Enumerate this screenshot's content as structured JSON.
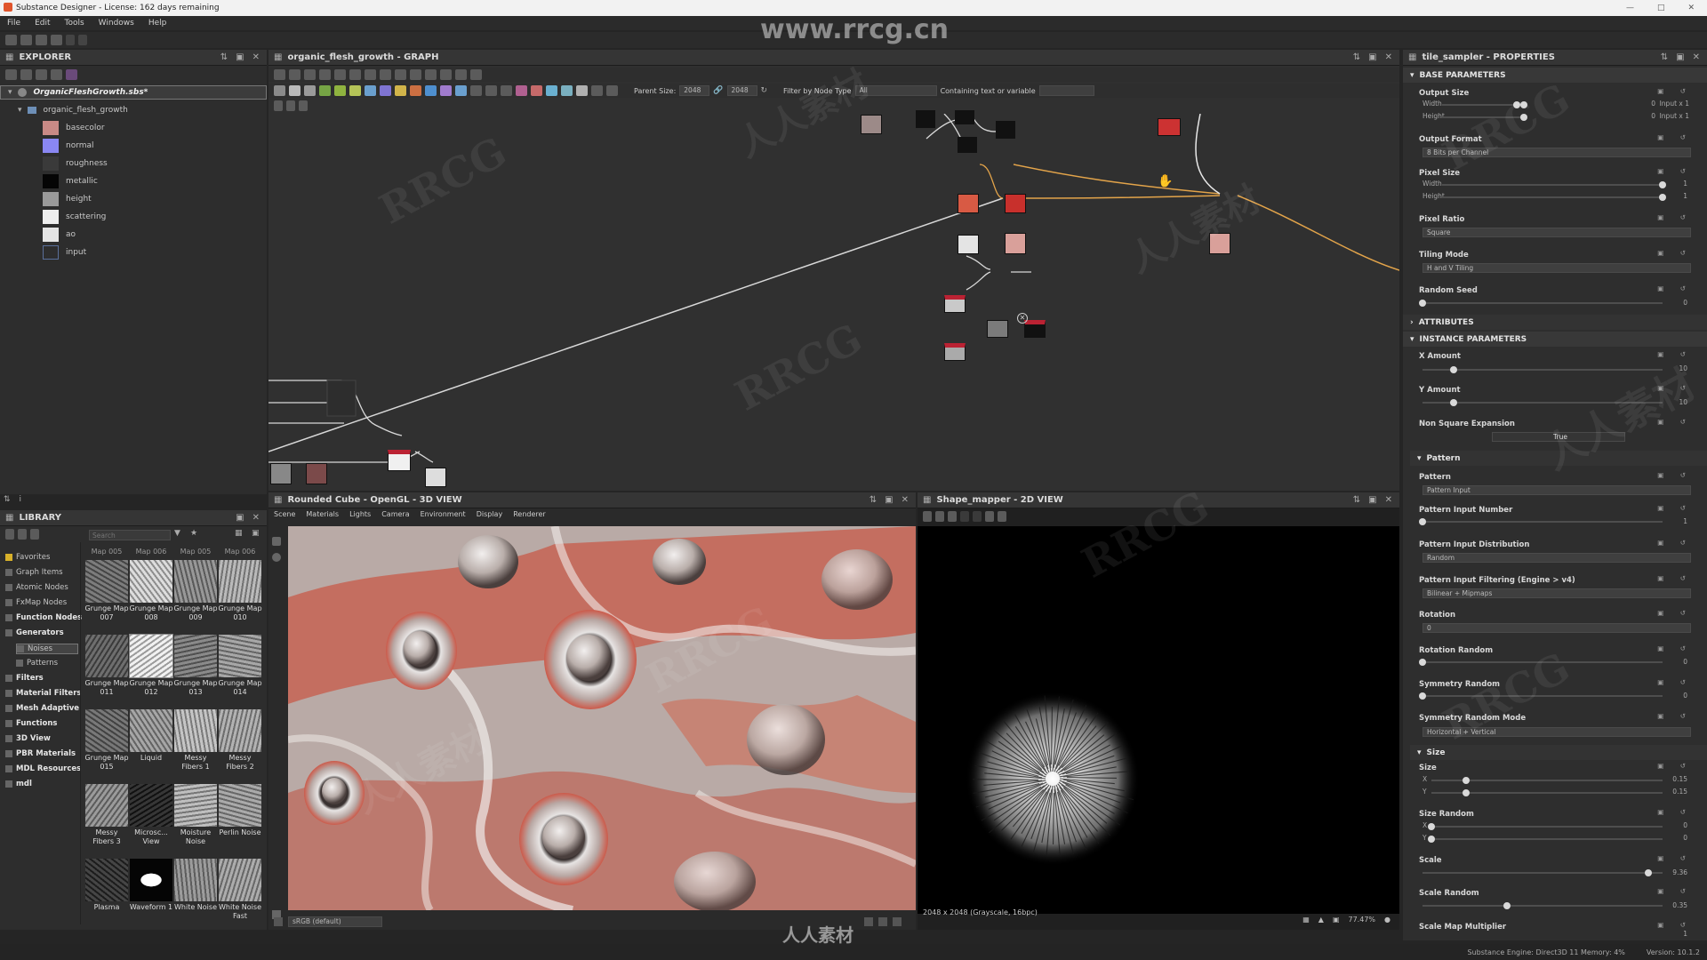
{
  "window": {
    "title": "Substance Designer - License: 162 days remaining"
  },
  "watermark": {
    "site": "www.rrcg.cn",
    "logo": "RRCG",
    "cn": "人人素材"
  },
  "menu": [
    "File",
    "Edit",
    "Tools",
    "Windows",
    "Help"
  ],
  "explorer": {
    "title": "EXPLORER",
    "package": "OrganicFleshGrowth.sbs*",
    "graph": "organic_flesh_growth",
    "outputs": [
      {
        "label": "basecolor",
        "color": "#c98a86"
      },
      {
        "label": "normal",
        "color": "#8a87f2"
      },
      {
        "label": "roughness",
        "color": "#3a3a3a"
      },
      {
        "label": "metallic",
        "color": "#050505"
      },
      {
        "label": "height",
        "color": "#9a9a9a"
      },
      {
        "label": "scattering",
        "color": "#eeeeee"
      },
      {
        "label": "ao",
        "color": "#e4e4e4"
      },
      {
        "label": "input",
        "color": "#2d2d2d"
      }
    ]
  },
  "graph": {
    "title": "organic_flesh_growth - GRAPH",
    "parent_size_label": "Parent Size:",
    "parent_size": "2048",
    "size2": "2048",
    "filter_label": "Filter by Node Type",
    "filter_value": "All",
    "containing_label": "Containing text or variable"
  },
  "library": {
    "title": "LIBRARY",
    "search_placeholder": "Search",
    "categories": [
      {
        "label": "Favorites",
        "bold": false
      },
      {
        "label": "Graph Items",
        "bold": false
      },
      {
        "label": "Atomic Nodes",
        "bold": false
      },
      {
        "label": "FxMap Nodes",
        "bold": false
      },
      {
        "label": "Function Nodes",
        "bold": true
      },
      {
        "label": "Generators",
        "bold": true
      },
      {
        "label": "Noises",
        "bold": false
      },
      {
        "label": "Patterns",
        "bold": false
      },
      {
        "label": "Filters",
        "bold": true
      },
      {
        "label": "Material Filters",
        "bold": true
      },
      {
        "label": "Mesh Adaptive",
        "bold": true
      },
      {
        "label": "Functions",
        "bold": true
      },
      {
        "label": "3D View",
        "bold": true
      },
      {
        "label": "PBR Materials",
        "bold": true
      },
      {
        "label": "MDL Resources",
        "bold": true
      },
      {
        "label": "mdl",
        "bold": true
      }
    ],
    "top_labels": [
      "Map 005",
      "Map 006",
      "Map 005",
      "Map 006"
    ],
    "thumbs": [
      {
        "label": "Grunge Map 007"
      },
      {
        "label": "Grunge Map 008"
      },
      {
        "label": "Grunge Map 009"
      },
      {
        "label": "Grunge Map 010"
      },
      {
        "label": "Grunge Map 011"
      },
      {
        "label": "Grunge Map 012"
      },
      {
        "label": "Grunge Map 013"
      },
      {
        "label": "Grunge Map 014"
      },
      {
        "label": "Grunge Map 015"
      },
      {
        "label": "Liquid"
      },
      {
        "label": "Messy Fibers 1"
      },
      {
        "label": "Messy Fibers 2"
      },
      {
        "label": "Messy Fibers 3"
      },
      {
        "label": "Microsc... View"
      },
      {
        "label": "Moisture Noise"
      },
      {
        "label": "Perlin Noise"
      },
      {
        "label": "Plasma"
      },
      {
        "label": "Waveform 1"
      },
      {
        "label": "White Noise"
      },
      {
        "label": "White Noise Fast"
      }
    ]
  },
  "view3d": {
    "title": "Rounded Cube - OpenGL - 3D VIEW",
    "menu": [
      "Scene",
      "Materials",
      "Lights",
      "Camera",
      "Environment",
      "Display",
      "Renderer"
    ],
    "colorspace": "sRGB (default)"
  },
  "view2d": {
    "title": "Shape_mapper - 2D VIEW",
    "info": "2048 x 2048 (Grayscale, 16bpc)",
    "zoom": "77.47%"
  },
  "properties": {
    "title": "tile_sampler - PROPERTIES",
    "base_header": "BASE PARAMETERS",
    "output_size": {
      "label": "Output Size",
      "width_label": "Width",
      "height_label": "Height",
      "width_val": "0",
      "height_val": "0",
      "width_rel": "Input x 1",
      "height_rel": "Input x 1"
    },
    "output_format": {
      "label": "Output Format",
      "value": "8 Bits per Channel"
    },
    "pixel_size": {
      "label": "Pixel Size",
      "width_label": "Width",
      "height_label": "Height",
      "width_val": "1",
      "height_val": "1"
    },
    "pixel_ratio": {
      "label": "Pixel Ratio",
      "value": "Square"
    },
    "tiling_mode": {
      "label": "Tiling Mode",
      "value": "H and V Tiling"
    },
    "random_seed": {
      "label": "Random Seed",
      "value": "0"
    },
    "attributes_header": "ATTRIBUTES",
    "instance_header": "INSTANCE PARAMETERS",
    "x_amount": {
      "label": "X Amount",
      "value": "10"
    },
    "y_amount": {
      "label": "Y Amount",
      "value": "10"
    },
    "non_square": {
      "label": "Non Square Expansion",
      "value": "True"
    },
    "pattern_header": "Pattern",
    "pattern": {
      "label": "Pattern",
      "value": "Pattern Input"
    },
    "pattern_input_number": {
      "label": "Pattern Input Number",
      "value": "1"
    },
    "pattern_input_distribution": {
      "label": "Pattern Input Distribution",
      "value": "Random"
    },
    "pattern_input_filtering": {
      "label": "Pattern Input Filtering (Engine > v4)",
      "value": "Bilinear + Mipmaps"
    },
    "rotation": {
      "label": "Rotation",
      "value": "0"
    },
    "rotation_random": {
      "label": "Rotation Random",
      "value": "0"
    },
    "symmetry_random": {
      "label": "Symmetry Random",
      "value": "0"
    },
    "symmetry_random_mode": {
      "label": "Symmetry Random Mode",
      "value": "Horizontal + Vertical"
    },
    "size_header": "Size",
    "size": {
      "label": "Size",
      "x_label": "X",
      "y_label": "Y",
      "x_val": "0.15",
      "y_val": "0.15"
    },
    "size_random": {
      "label": "Size Random",
      "x_label": "X",
      "y_label": "Y",
      "x_val": "0",
      "y_val": "0"
    },
    "scale": {
      "label": "Scale",
      "value": "9.36"
    },
    "scale_random": {
      "label": "Scale Random",
      "value": "0.35"
    },
    "scale_map_multiplier": {
      "label": "Scale Map Multiplier",
      "value": "1"
    }
  },
  "status": {
    "engine": "Substance Engine: Direct3D 11  Memory: 4%",
    "version": "Version: 10.1.2"
  }
}
